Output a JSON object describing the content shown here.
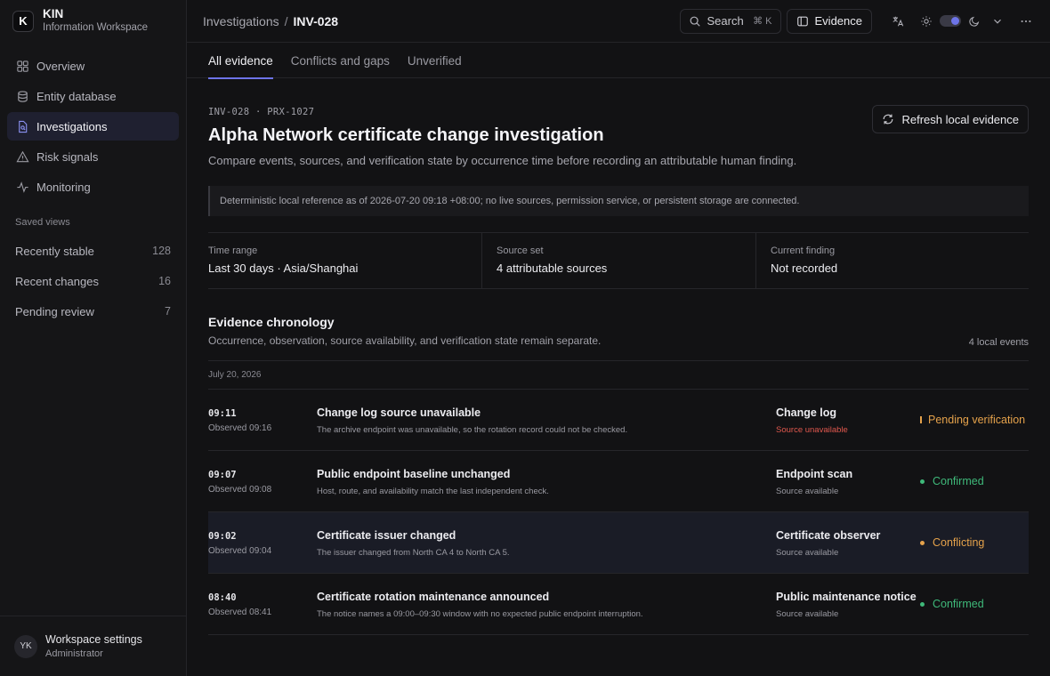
{
  "brand": {
    "logo_letter": "K",
    "name": "KIN",
    "subtitle": "Information Workspace"
  },
  "nav": [
    {
      "label": "Overview",
      "icon": "grid-icon"
    },
    {
      "label": "Entity database",
      "icon": "database-icon"
    },
    {
      "label": "Investigations",
      "icon": "file-search-icon",
      "active": true
    },
    {
      "label": "Risk signals",
      "icon": "warning-triangle-icon"
    },
    {
      "label": "Monitoring",
      "icon": "activity-icon"
    }
  ],
  "saved_views": {
    "title": "Saved views",
    "items": [
      {
        "label": "Recently stable",
        "count": "128"
      },
      {
        "label": "Recent changes",
        "count": "16"
      },
      {
        "label": "Pending review",
        "count": "7"
      }
    ]
  },
  "footer": {
    "initials": "YK",
    "name": "Workspace settings",
    "role": "Administrator"
  },
  "topbar": {
    "breadcrumb_parent": "Investigations",
    "breadcrumb_sep": "/",
    "breadcrumb_current": "INV-028",
    "search_label": "Search",
    "search_shortcut": "⌘ K",
    "evidence_label": "Evidence"
  },
  "tabs": [
    {
      "label": "All evidence",
      "active": true
    },
    {
      "label": "Conflicts and gaps"
    },
    {
      "label": "Unverified"
    }
  ],
  "header": {
    "ids": "INV-028 · PRX-1027",
    "title": "Alpha Network certificate change investigation",
    "description": "Compare events, sources, and verification state by occurrence time before recording an attributable human finding.",
    "refresh_label": "Refresh local evidence"
  },
  "notice": "Deterministic local reference as of 2026-07-20 09:18 +08:00; no live sources, permission service, or persistent storage are connected.",
  "meta": [
    {
      "label": "Time range",
      "value": "Last 30 days · Asia/Shanghai"
    },
    {
      "label": "Source set",
      "value": "4 attributable sources"
    },
    {
      "label": "Current finding",
      "value": "Not recorded"
    }
  ],
  "chronology": {
    "title": "Evidence chronology",
    "description": "Occurrence, observation, source availability, and verification state remain separate.",
    "count": "4 local events",
    "date": "July 20, 2026",
    "events": [
      {
        "time": "09:11",
        "observed": "Observed 09:16",
        "title": "Change log source unavailable",
        "desc": "The archive endpoint was unavailable, so the rotation record could not be checked.",
        "source": "Change log",
        "availability": "Source unavailable",
        "status": "Pending verification",
        "status_color": "#e5a24b"
      },
      {
        "time": "09:07",
        "observed": "Observed 09:08",
        "title": "Public endpoint baseline unchanged",
        "desc": "Host, route, and availability match the last independent check.",
        "source": "Endpoint scan",
        "availability": "Source available",
        "status": "Confirmed",
        "status_color": "#3fb97a"
      },
      {
        "time": "09:02",
        "observed": "Observed 09:04",
        "title": "Certificate issuer changed",
        "desc": "The issuer changed from North CA 4 to North CA 5.",
        "source": "Certificate observer",
        "availability": "Source available",
        "status": "Conflicting",
        "status_color": "#e5a24b"
      },
      {
        "time": "08:40",
        "observed": "Observed 08:41",
        "title": "Certificate rotation maintenance announced",
        "desc": "The notice names a 09:00–09:30 window with no expected public endpoint interruption.",
        "source": "Public maintenance notice",
        "availability": "Source available",
        "status": "Confirmed",
        "status_color": "#3fb97a"
      }
    ]
  }
}
